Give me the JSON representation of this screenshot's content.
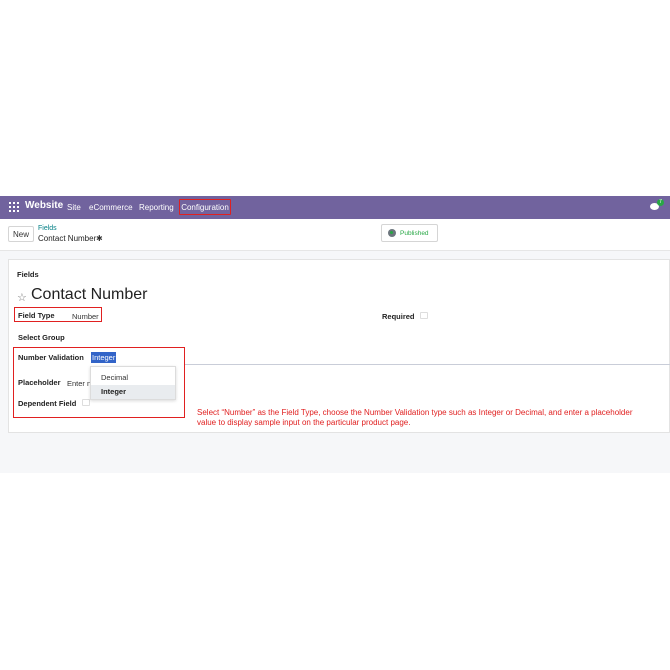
{
  "navbar": {
    "brand": "Website",
    "menu": [
      "Site",
      "eCommerce",
      "Reporting",
      "Configuration"
    ],
    "chat_badge": "7",
    "bg_color": "#71639e"
  },
  "control": {
    "new_label": "New",
    "breadcrumb_parent": "Fields",
    "breadcrumb_current": "Contact Number",
    "published_label": "Published"
  },
  "form": {
    "section_label": "Fields",
    "title": "Contact Number",
    "field_type_label": "Field Type",
    "field_type_value": "Number",
    "required_label": "Required",
    "select_group_label": "Select Group",
    "number_validation_label": "Number Validation",
    "number_validation_value": "Integer",
    "placeholder_label": "Placeholder",
    "placeholder_value": "Enter n",
    "dependent_field_label": "Dependent Field"
  },
  "dropdown": {
    "options": [
      "Decimal",
      "Integer"
    ],
    "selected": "Integer"
  },
  "caption": "Select “Number” as the Field Type, choose the Number Validation type such as Integer or Decimal, and enter a placeholder value to display sample input on the particular product page.",
  "colors": {
    "highlight_border": "#e02020",
    "accent": "#71639e",
    "published": "#28a745"
  }
}
